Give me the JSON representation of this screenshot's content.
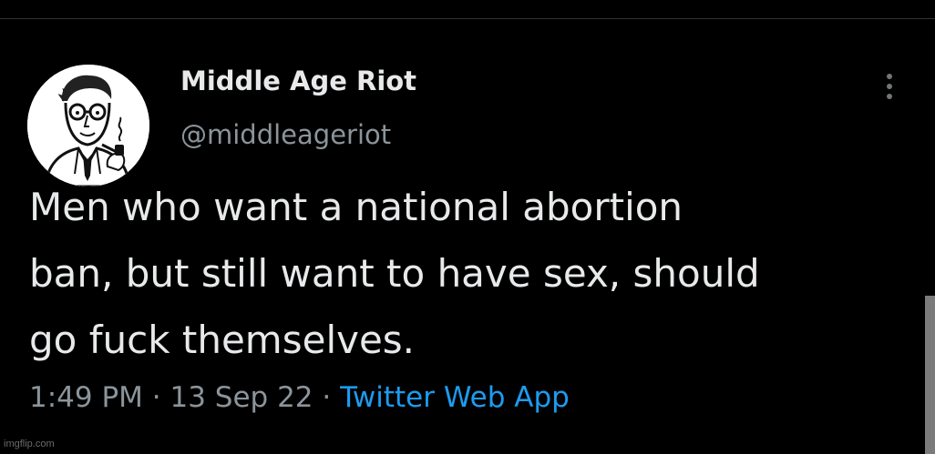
{
  "author": {
    "display_name": "Middle Age Riot",
    "handle": "@middleageriot",
    "avatar_icon": "pipe-smoking-man-illustration"
  },
  "tweet": {
    "text": "Men who want a national abortion\nban, but still want to have sex, should\ngo fuck themselves."
  },
  "meta": {
    "time": "1:49 PM",
    "separator_1": " · ",
    "date": "13 Sep 22",
    "separator_2": " · ",
    "source": "Twitter Web App"
  },
  "watermark": "imgflip.com",
  "colors": {
    "background": "#000000",
    "text_primary": "#e7e9ea",
    "text_secondary": "#8b949b",
    "link": "#1d9bf0"
  }
}
